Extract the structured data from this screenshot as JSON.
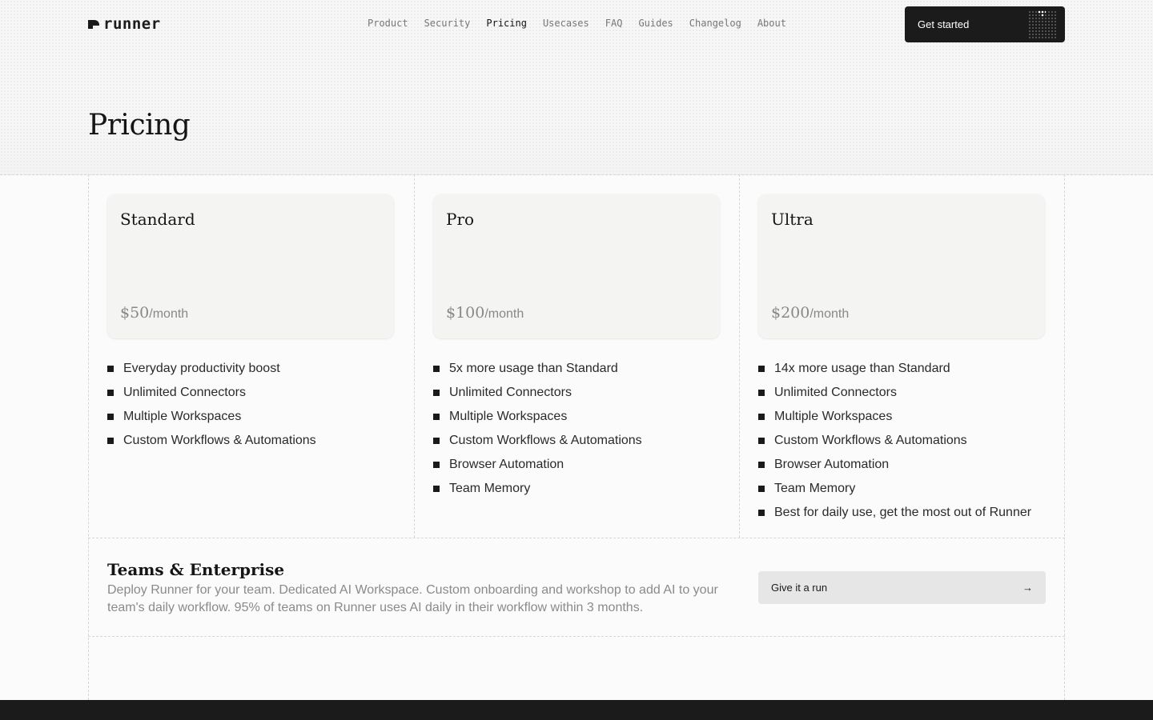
{
  "nav": {
    "logo_text": "runner",
    "links": [
      {
        "label": "Product",
        "active": false
      },
      {
        "label": "Security",
        "active": false
      },
      {
        "label": "Pricing",
        "active": true
      },
      {
        "label": "Usecases",
        "active": false
      },
      {
        "label": "FAQ",
        "active": false
      },
      {
        "label": "Guides",
        "active": false
      },
      {
        "label": "Changelog",
        "active": false
      },
      {
        "label": "About",
        "active": false
      }
    ],
    "cta_label": "Get started"
  },
  "page_title": "Pricing",
  "plans": [
    {
      "name": "Standard",
      "price": "$50",
      "period": "/month",
      "features": [
        "Everyday productivity boost",
        "Unlimited Connectors",
        "Multiple Workspaces",
        "Custom Workflows & Automations"
      ]
    },
    {
      "name": "Pro",
      "price": "$100",
      "period": "/month",
      "features": [
        "5x more usage than Standard",
        "Unlimited Connectors",
        "Multiple Workspaces",
        "Custom Workflows & Automations",
        "Browser Automation",
        "Team Memory"
      ]
    },
    {
      "name": "Ultra",
      "price": "$200",
      "period": "/month",
      "features": [
        "14x more usage than Standard",
        "Unlimited Connectors",
        "Multiple Workspaces",
        "Custom Workflows & Automations",
        "Browser Automation",
        "Team Memory",
        "Best for daily use, get the most out of Runner"
      ]
    }
  ],
  "enterprise": {
    "title": "Teams & Enterprise",
    "description": "Deploy Runner for your team. Dedicated AI Workspace. Custom onboarding and workshop to add AI to your team's daily workflow. 95% of teams on Runner uses AI daily in their workflow within 3 months.",
    "button_label": "Give it a run",
    "button_icon": "arrow-right-icon"
  },
  "colors": {
    "accent_dark": "#1b1b1b",
    "card_bg": "#f4f4f2",
    "muted_text": "#8a8a8a"
  }
}
